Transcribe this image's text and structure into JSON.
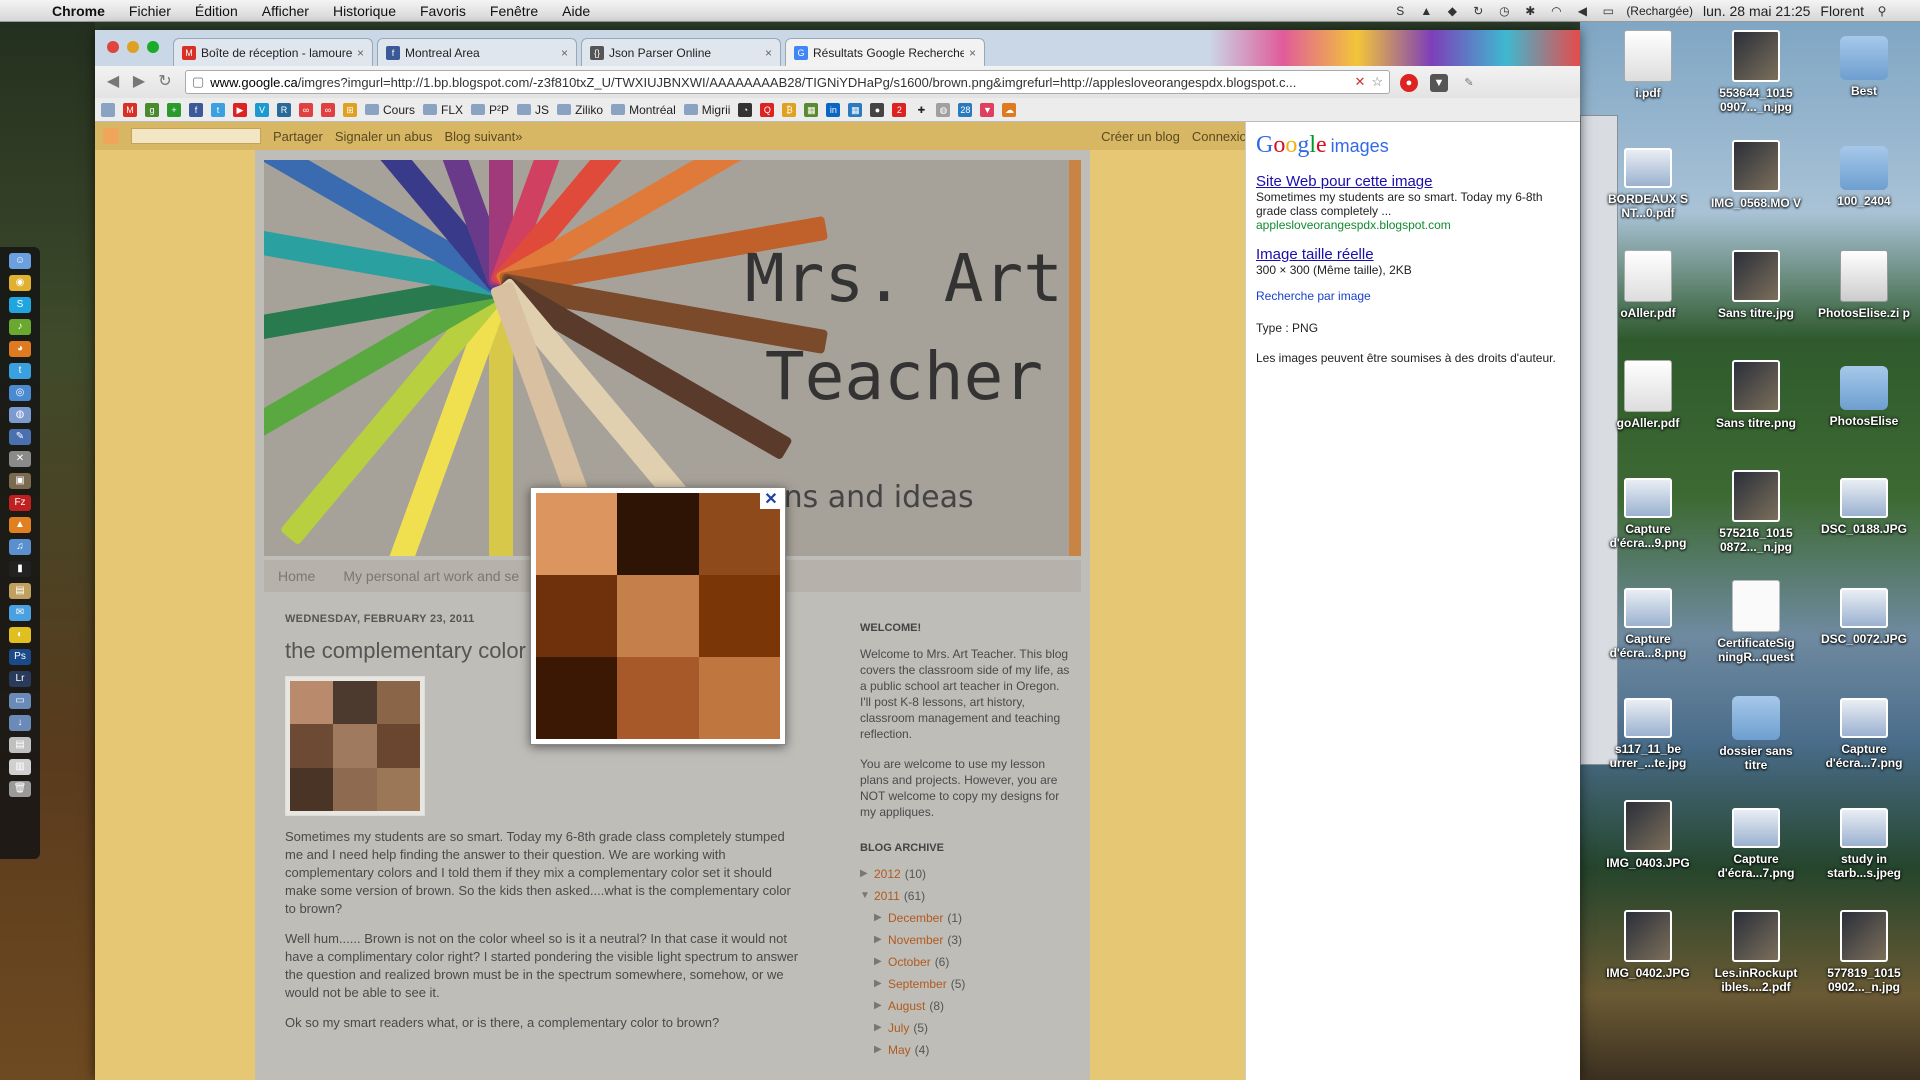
{
  "menubar": {
    "app": "Chrome",
    "items": [
      "Fichier",
      "Édition",
      "Afficher",
      "Historique",
      "Favoris",
      "Fenêtre",
      "Aide"
    ],
    "battery_text": "(Rechargée)",
    "clock": "lun. 28 mai  21:25",
    "user": "Florent"
  },
  "browser": {
    "tabs": [
      {
        "label": "Boîte de réception - lamoure",
        "favicon": "gmail-icon",
        "color": "#d93025"
      },
      {
        "label": "Montreal Area",
        "favicon": "facebook-icon",
        "color": "#3b5998"
      },
      {
        "label": "Json Parser Online",
        "favicon": "json-icon",
        "color": "#555555"
      },
      {
        "label": "Résultats Google Recherche",
        "favicon": "google-icon",
        "color": "#4285f4"
      }
    ],
    "url_host": "www.google.ca",
    "url_rest": "/imgres?imgurl=http://1.bp.blogspot.com/-z3f810txZ_U/TWXIUJBNXWI/AAAAAAAAB28/TIGNiYDHaPg/s1600/brown.png&imgrefurl=http://applesloveorangespdx.blogspot.c...",
    "bookmarks": [
      "Cours",
      "FLX",
      "P²P",
      "JS",
      "Ziliko",
      "Montréal",
      "Migrii"
    ]
  },
  "blogger_bar": {
    "links": [
      "Partager",
      "Signaler un abus",
      "Blog suivant»"
    ],
    "right_links": [
      "Créer un blog",
      "Connexion"
    ]
  },
  "blog": {
    "header_title_line1": "Mrs. Art",
    "header_title_line2": "Teacher",
    "header_subtitle": "ssons and ideas",
    "nav": [
      "Home",
      "My personal art work and se"
    ],
    "post_date": "WEDNESDAY, FEBRUARY 23, 2011",
    "post_title": "the complementary color",
    "paragraphs": [
      "Sometimes my students are so smart. Today my 6-8th grade class completely stumped me and I need help finding the answer to their question. We are working with complementary colors and I told them if they mix a complementary color set it should make some version of brown. So the kids then asked....what is the complementary color to brown?",
      "Well hum...... Brown is not on the color wheel so is it a neutral? In that case it would not have a complimentary color right? I started pondering the visible light spectrum to answer the question and realized brown must be in the spectrum somewhere, somehow, or we would not be able to see it.",
      "Ok so my smart readers what, or is there, a complementary color to brown?"
    ],
    "sidebar": {
      "welcome_heading": "WELCOME!",
      "welcome_text": "Welcome to Mrs. Art Teacher. This blog covers the classroom side of my life, as a public school art teacher in Oregon. I'll post K-8 lessons, art history, classroom management and teaching reflection.",
      "welcome_text2": "You are welcome to use my lesson plans and projects. However, you are NOT welcome to copy my designs for my appliques.",
      "archive_heading": "BLOG ARCHIVE",
      "archive": [
        {
          "label": "2012",
          "count": "(10)",
          "arrow": "▶",
          "level": 0
        },
        {
          "label": "2011",
          "count": "(61)",
          "arrow": "▼",
          "level": 0
        },
        {
          "label": "December",
          "count": "(1)",
          "arrow": "▶",
          "level": 1
        },
        {
          "label": "November",
          "count": "(3)",
          "arrow": "▶",
          "level": 1
        },
        {
          "label": "October",
          "count": "(6)",
          "arrow": "▶",
          "level": 1
        },
        {
          "label": "September",
          "count": "(5)",
          "arrow": "▶",
          "level": 1
        },
        {
          "label": "August",
          "count": "(8)",
          "arrow": "▶",
          "level": 1
        },
        {
          "label": "July",
          "count": "(5)",
          "arrow": "▶",
          "level": 1
        },
        {
          "label": "May",
          "count": "(4)",
          "arrow": "▶",
          "level": 1
        }
      ]
    }
  },
  "swatch_colors": [
    "#dd955f",
    "#2e1404",
    "#8f4a1b",
    "#6e310b",
    "#c57f4b",
    "#7b3608",
    "#3a1804",
    "#a7592a",
    "#c0773f"
  ],
  "thumb_colors": [
    "#b98a6c",
    "#4d3a2f",
    "#8b6548",
    "#6d4a33",
    "#a07a5e",
    "#6a4630",
    "#4a3426",
    "#8e6a50",
    "#9b7657"
  ],
  "google_panel": {
    "logo_letters": [
      "G",
      "o",
      "o",
      "g",
      "l",
      "e"
    ],
    "logo_suffix": "images",
    "site_link": "Site Web pour cette image",
    "site_desc": "Sometimes my students are so smart. Today my 6-8th grade class completely ...",
    "site_url": "applesloveorangespdx.blogspot.com",
    "full_size_link": "Image taille réelle",
    "full_size_info": "300 × 300 (Même taille), 2KB",
    "search_by_image": "Recherche par image",
    "type_line": "Type :  PNG",
    "rights": "Les images peuvent être soumises à des droits d'auteur."
  },
  "desktop_icons": [
    {
      "label": "i.pdf",
      "kind": "pdf"
    },
    {
      "label": "553644_1015 0907..._n.jpg",
      "kind": "photo"
    },
    {
      "label": "Best",
      "kind": "folder"
    },
    {
      "label": "BORDEAUX S NT...0.pdf",
      "kind": "shot"
    },
    {
      "label": "IMG_0568.MO V",
      "kind": "photo"
    },
    {
      "label": "100_2404",
      "kind": "folder"
    },
    {
      "label": "oAller.pdf",
      "kind": "pdf"
    },
    {
      "label": "Sans titre.jpg",
      "kind": "photo"
    },
    {
      "label": "PhotosElise.zi p",
      "kind": "zip"
    },
    {
      "label": "goAller.pdf",
      "kind": "pdf"
    },
    {
      "label": "Sans titre.png",
      "kind": "photo"
    },
    {
      "label": "PhotosElise",
      "kind": "folder"
    },
    {
      "label": "Capture d'écra...9.png",
      "kind": "shot"
    },
    {
      "label": "575216_1015 0872..._n.jpg",
      "kind": "photo"
    },
    {
      "label": "DSC_0188.JPG",
      "kind": "shot"
    },
    {
      "label": "Capture d'écra...8.png",
      "kind": "shot"
    },
    {
      "label": "CertificateSig ningR...quest",
      "kind": "doc"
    },
    {
      "label": "DSC_0072.JPG",
      "kind": "shot"
    },
    {
      "label": "s117_11_be urrer_...te.jpg",
      "kind": "shot"
    },
    {
      "label": "dossier sans titre",
      "kind": "folder"
    },
    {
      "label": "Capture d'écra...7.png",
      "kind": "shot"
    },
    {
      "label": "IMG_0403.JPG",
      "kind": "photo"
    },
    {
      "label": "Capture d'écra...7.png",
      "kind": "shot"
    },
    {
      "label": "study in starb...s.jpeg",
      "kind": "shot"
    },
    {
      "label": "IMG_0402.JPG",
      "kind": "photo"
    },
    {
      "label": "Les.inRockupt ibles....2.pdf",
      "kind": "photo"
    },
    {
      "label": "577819_1015 0902..._n.jpg",
      "kind": "photo"
    }
  ]
}
